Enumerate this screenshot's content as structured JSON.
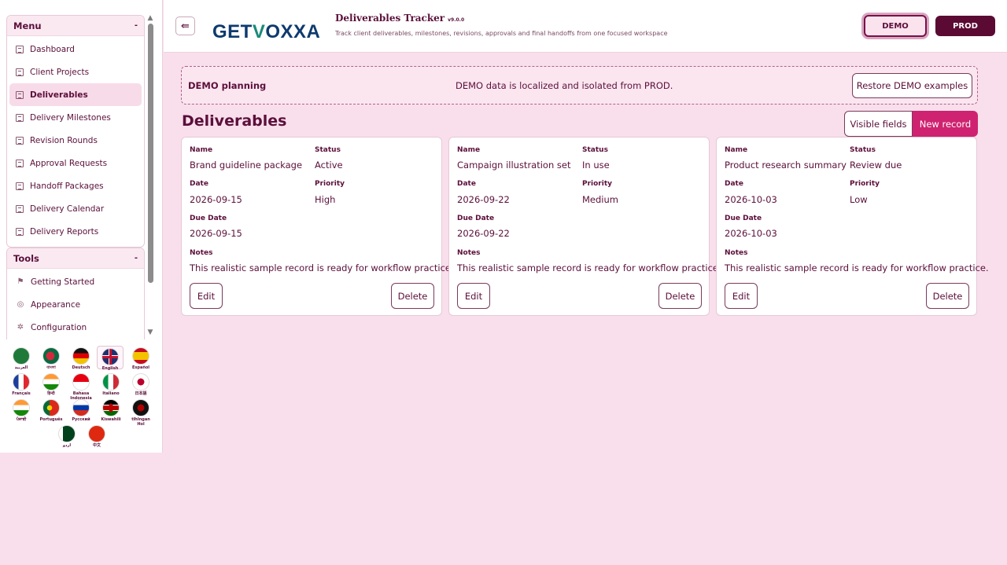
{
  "sidebar": {
    "menu_title": "Menu",
    "menu_collapse": "-",
    "menu_items": [
      {
        "label": "Dashboard"
      },
      {
        "label": "Client Projects"
      },
      {
        "label": "Deliverables",
        "active": true
      },
      {
        "label": "Delivery Milestones"
      },
      {
        "label": "Revision Rounds"
      },
      {
        "label": "Approval Requests"
      },
      {
        "label": "Handoff Packages"
      },
      {
        "label": "Delivery Calendar"
      },
      {
        "label": "Delivery Reports"
      }
    ],
    "tools_title": "Tools",
    "tools_collapse": "-",
    "tools_items": [
      {
        "label": "Getting Started",
        "icon": "flag-icon"
      },
      {
        "label": "Appearance",
        "icon": "palette-icon"
      },
      {
        "label": "Configuration",
        "icon": "gear-icon"
      }
    ]
  },
  "languages": [
    {
      "label": "العربية"
    },
    {
      "label": "বাংলা"
    },
    {
      "label": "Deutsch"
    },
    {
      "label": "English",
      "selected": true
    },
    {
      "label": "Español"
    },
    {
      "label": "Français"
    },
    {
      "label": "हिन्दी"
    },
    {
      "label": "Bahasa Indonesia"
    },
    {
      "label": "Italiano"
    },
    {
      "label": "日本語"
    },
    {
      "label": "ਪੰਜਾਬੀ"
    },
    {
      "label": "Português"
    },
    {
      "label": "Русский"
    },
    {
      "label": "Kiswahili"
    },
    {
      "label": "tlhIngan Hol"
    },
    {
      "label": "اردو"
    },
    {
      "label": "中文"
    }
  ],
  "header": {
    "back_icon": "⇚",
    "logo_prefix": "GET",
    "logo_v": "V",
    "logo_suffix": "OXXA",
    "title": "Deliverables Tracker",
    "version": "v9.0.0",
    "subtitle": "Track client deliverables, milestones, revisions, approvals and final handoffs from one focused workspace",
    "env_demo": "DEMO",
    "env_prod": "PROD"
  },
  "banner": {
    "title": "DEMO planning",
    "message": "DEMO data is localized and isolated from PROD.",
    "restore_label": "Restore DEMO examples"
  },
  "main": {
    "title": "Deliverables",
    "visible_fields_label": "Visible fields",
    "new_record_label": "New record"
  },
  "field_labels": {
    "name": "Name",
    "status": "Status",
    "date": "Date",
    "priority": "Priority",
    "due_date": "Due Date",
    "notes": "Notes"
  },
  "card_actions": {
    "edit": "Edit",
    "delete": "Delete"
  },
  "records": [
    {
      "name": "Brand guideline package",
      "status": "Active",
      "date": "2026-09-15",
      "priority": "High",
      "due_date": "2026-09-15",
      "notes": "This realistic sample record is ready for workflow practice."
    },
    {
      "name": "Campaign illustration set",
      "status": "In use",
      "date": "2026-09-22",
      "priority": "Medium",
      "due_date": "2026-09-22",
      "notes": "This realistic sample record is ready for workflow practice."
    },
    {
      "name": "Product research summary",
      "status": "Review due",
      "date": "2026-10-03",
      "priority": "Low",
      "due_date": "2026-10-03",
      "notes": "This realistic sample record is ready for workflow practice."
    }
  ]
}
